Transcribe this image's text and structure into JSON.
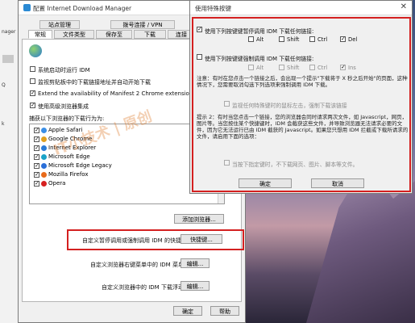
{
  "desktop": {
    "left_strip": {
      "label1": "nager",
      "label2": "Q",
      "label3": "k"
    }
  },
  "main_dialog": {
    "title": "配置 Internet Download Manager",
    "close": "✕",
    "tabs_row1": [
      "站点管理",
      "拨号连接 / VPN"
    ],
    "tabs_row2": [
      "常规",
      "文件类型",
      "保存至",
      "下载",
      "连接"
    ],
    "opt_autostart": "系统启动时运行 IDM",
    "opt_monitor_clipboard": "监视剪贴板中的下载链接地址并自动开始下载",
    "opt_manifest": "Extend the availability of Manifest 2 Chrome extensions",
    "opt_advanced": "使用高级浏览器集成",
    "browsers_label": "捕获以下浏览器的下载行为为:",
    "browsers": [
      {
        "name": "Apple Safari",
        "color": "#3a8ee6"
      },
      {
        "name": "Google Chrome",
        "color": "#e0a020"
      },
      {
        "name": "Internet Explorer",
        "color": "#2a7bd6"
      },
      {
        "name": "Microsoft Edge",
        "color": "#1aa3c8"
      },
      {
        "name": "Microsoft Edge Legacy",
        "color": "#2b6fd8"
      },
      {
        "name": "Mozilla Firefox",
        "color": "#e86a1a"
      },
      {
        "name": "Opera",
        "color": "#d62020"
      }
    ],
    "add_browser_btn": "添加浏览器...",
    "hotkey_label": "自定义暂停调用或强制调用 IDM 的快捷键",
    "hotkey_btn": "快捷键...",
    "menu_label": "自定义浏览器右键菜单中的 IDM 菜单项",
    "menu_btn": "编辑...",
    "float_label": "自定义浏览器中的 IDM 下载浮动条",
    "float_btn": "编辑...",
    "ok": "确定",
    "help": "帮助",
    "watermark": "IT小技术 | 原创"
  },
  "hotkey_dialog": {
    "title": "使用特殊按键",
    "close": "✕",
    "disable_label": "使用下列按键键暂停调用 IDM 下载任何链接:",
    "keys1": [
      "Alt",
      "Shift",
      "Ctrl",
      "Del"
    ],
    "force_label": "使用下列按键键强制调用 IDM 下载任何链接:",
    "keys2": [
      "Alt",
      "Shift",
      "Ctrl",
      "Ins"
    ],
    "note1": "注意：有时在您点击一个链接之后，会出现一个提示\"下载将于 X 秒之后开始\"的页面，这种情况下，您需要取消勾选下列选项来强制调用 IDM 下载。",
    "opt_monitor_left": "监视任何特殊键时的鼠标左击，强制下载该链接",
    "note2": "提示 2：有时当您点击一个链接，您的浏览器会同时请求两次文件，如 Javascript，网页，图片等。当您按住某个快捷键时，IDM 会截获这些文件，并导致浏览器无法请求必要的文件，因为它无法运行已由 IDM 截获的 Javascript。如果您只想用 IDM 拦截或下载所请求的文件，请启用下面的选项：",
    "opt_only_links": "当按下指定键时，不下载网页、图片、脚本等文件。",
    "ok": "确定",
    "cancel": "取消"
  }
}
